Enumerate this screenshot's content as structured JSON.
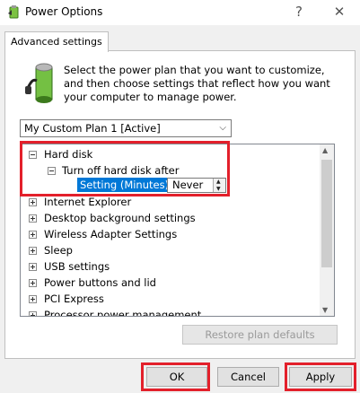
{
  "window": {
    "title": "Power Options",
    "help_glyph": "?",
    "close_glyph": "✕"
  },
  "tabs": [
    {
      "label": "Advanced settings"
    }
  ],
  "intro": {
    "text": "Select the power plan that you want to customize, and then choose settings that reflect how you want your computer to manage power."
  },
  "plan_select": {
    "value": "My Custom Plan 1 [Active]"
  },
  "tree": {
    "items": [
      {
        "label": "Hard disk",
        "expanded": true
      },
      {
        "label": "Turn off hard disk after",
        "expanded": true
      },
      {
        "label": "Setting (Minutes):",
        "value": "Never"
      },
      {
        "label": "Internet Explorer"
      },
      {
        "label": "Desktop background settings"
      },
      {
        "label": "Wireless Adapter Settings"
      },
      {
        "label": "Sleep"
      },
      {
        "label": "USB settings"
      },
      {
        "label": "Power buttons and lid"
      },
      {
        "label": "PCI Express"
      },
      {
        "label": "Processor power management"
      }
    ]
  },
  "buttons": {
    "restore": "Restore plan defaults",
    "ok": "OK",
    "cancel": "Cancel",
    "apply": "Apply"
  },
  "colors": {
    "highlight": "#e3202b",
    "selection": "#0078d7"
  }
}
